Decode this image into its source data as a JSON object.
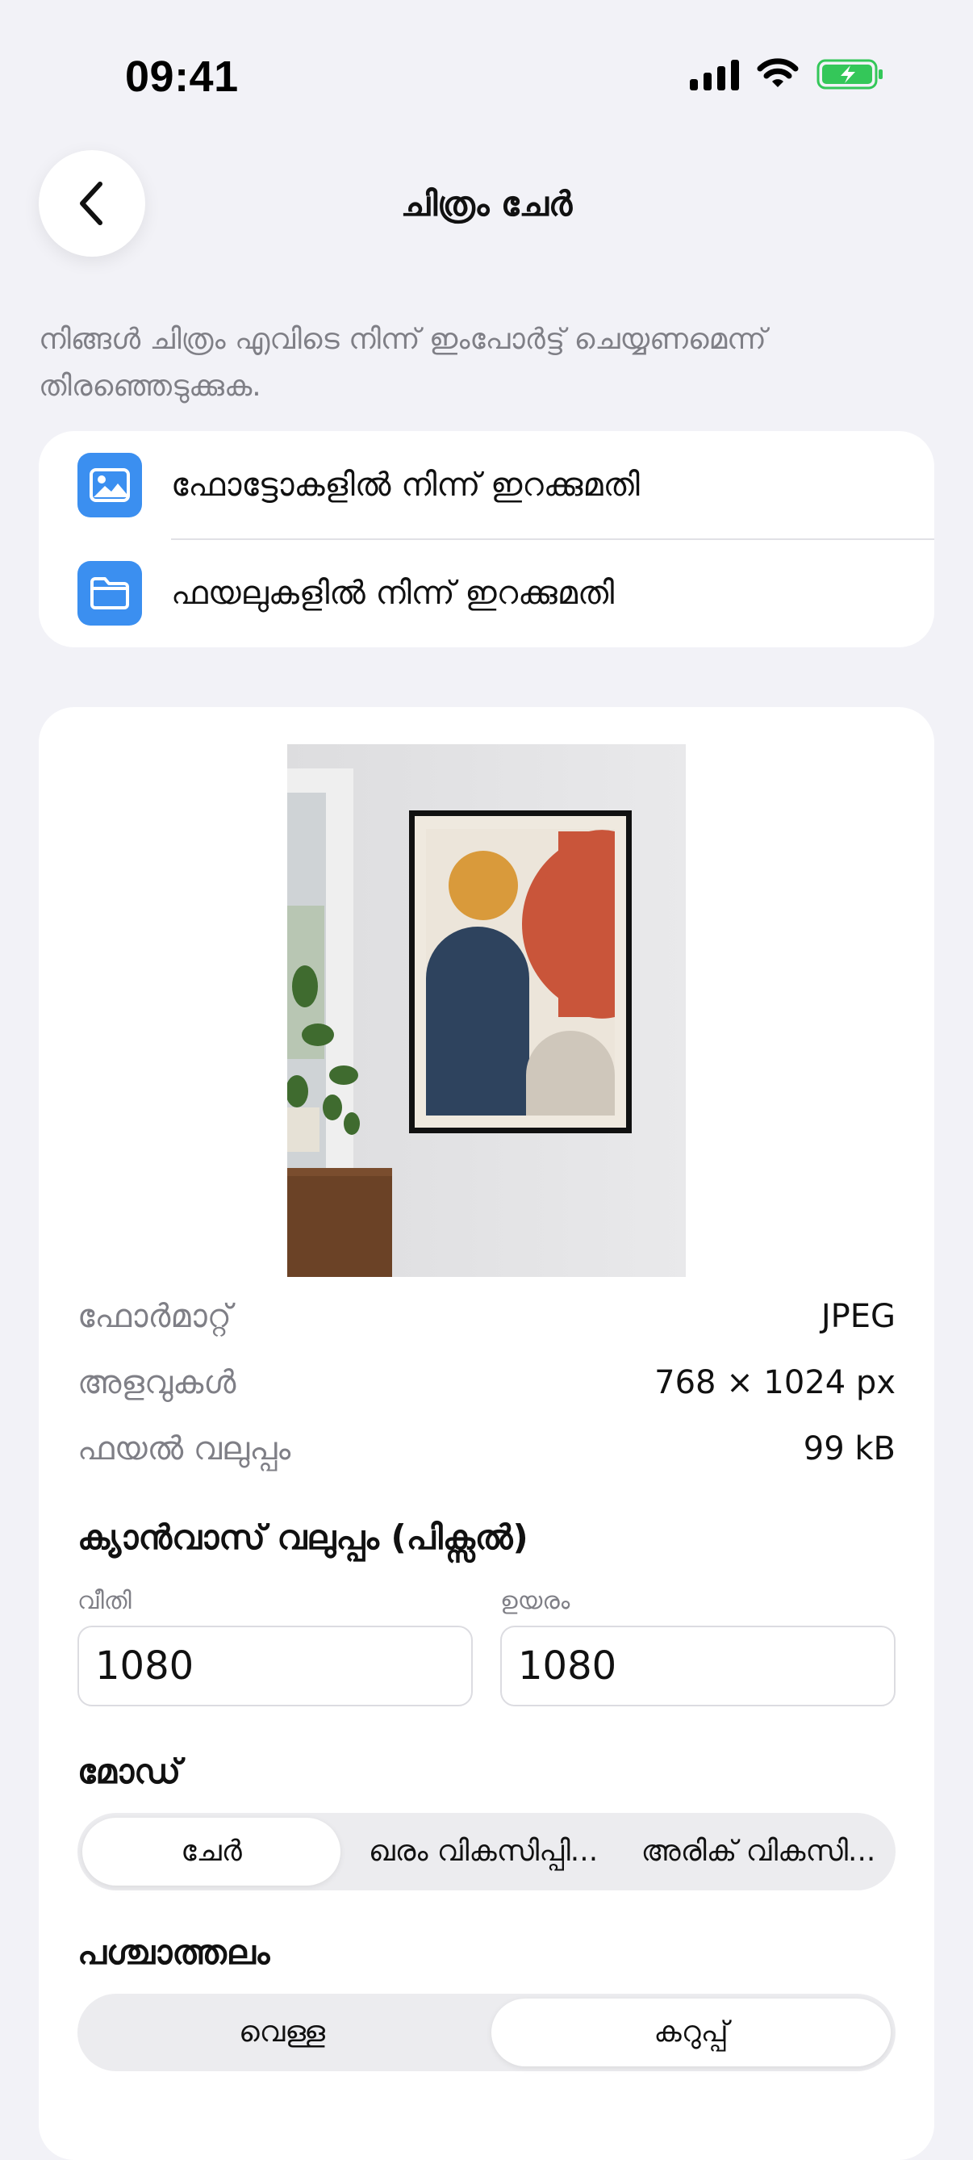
{
  "status_bar": {
    "time": "09:41"
  },
  "nav": {
    "title": "ചിത്രം ചേർ"
  },
  "description": "നിങ്ങൾ ചിത്രം എവിടെ നിന്ന് ഇംപോർട്ട് ചെയ്യണമെന്ന് തിരഞ്ഞെടുക്കുക.",
  "import_options": [
    {
      "label": "ഫോട്ടോകളിൽ നിന്ന് ഇറക്കുമതി",
      "icon": "photo-icon"
    },
    {
      "label": "ഫയലുകളിൽ നിന്ന് ഇറക്കുമതി",
      "icon": "folder-icon"
    }
  ],
  "image_info": {
    "format_label": "ഫോർമാറ്റ്",
    "format_value": "JPEG",
    "dimensions_label": "അളവുകൾ",
    "dimensions_value": "768 × 1024 px",
    "filesize_label": "ഫയൽ വലുപ്പം",
    "filesize_value": "99 kB"
  },
  "canvas": {
    "title": "ക്യാൻവാസ് വലുപ്പം (പിക്സൽ)",
    "width_label": "വീതി",
    "width_value": "1080",
    "height_label": "ഉയരം",
    "height_value": "1080"
  },
  "mode": {
    "title": "മോഡ്",
    "options": [
      "ചേർ",
      "ഖരം വികസിപ്പി...",
      "അരിക് വികസി..."
    ],
    "selected": 0
  },
  "background": {
    "title": "പശ്ചാത്തലം",
    "options": [
      "വെള്ള",
      "കറുപ്പ്"
    ],
    "selected": 1
  },
  "colors": {
    "accent": "#3b8ff0",
    "battery": "#34c759",
    "page_bg": "#f2f2f7"
  }
}
